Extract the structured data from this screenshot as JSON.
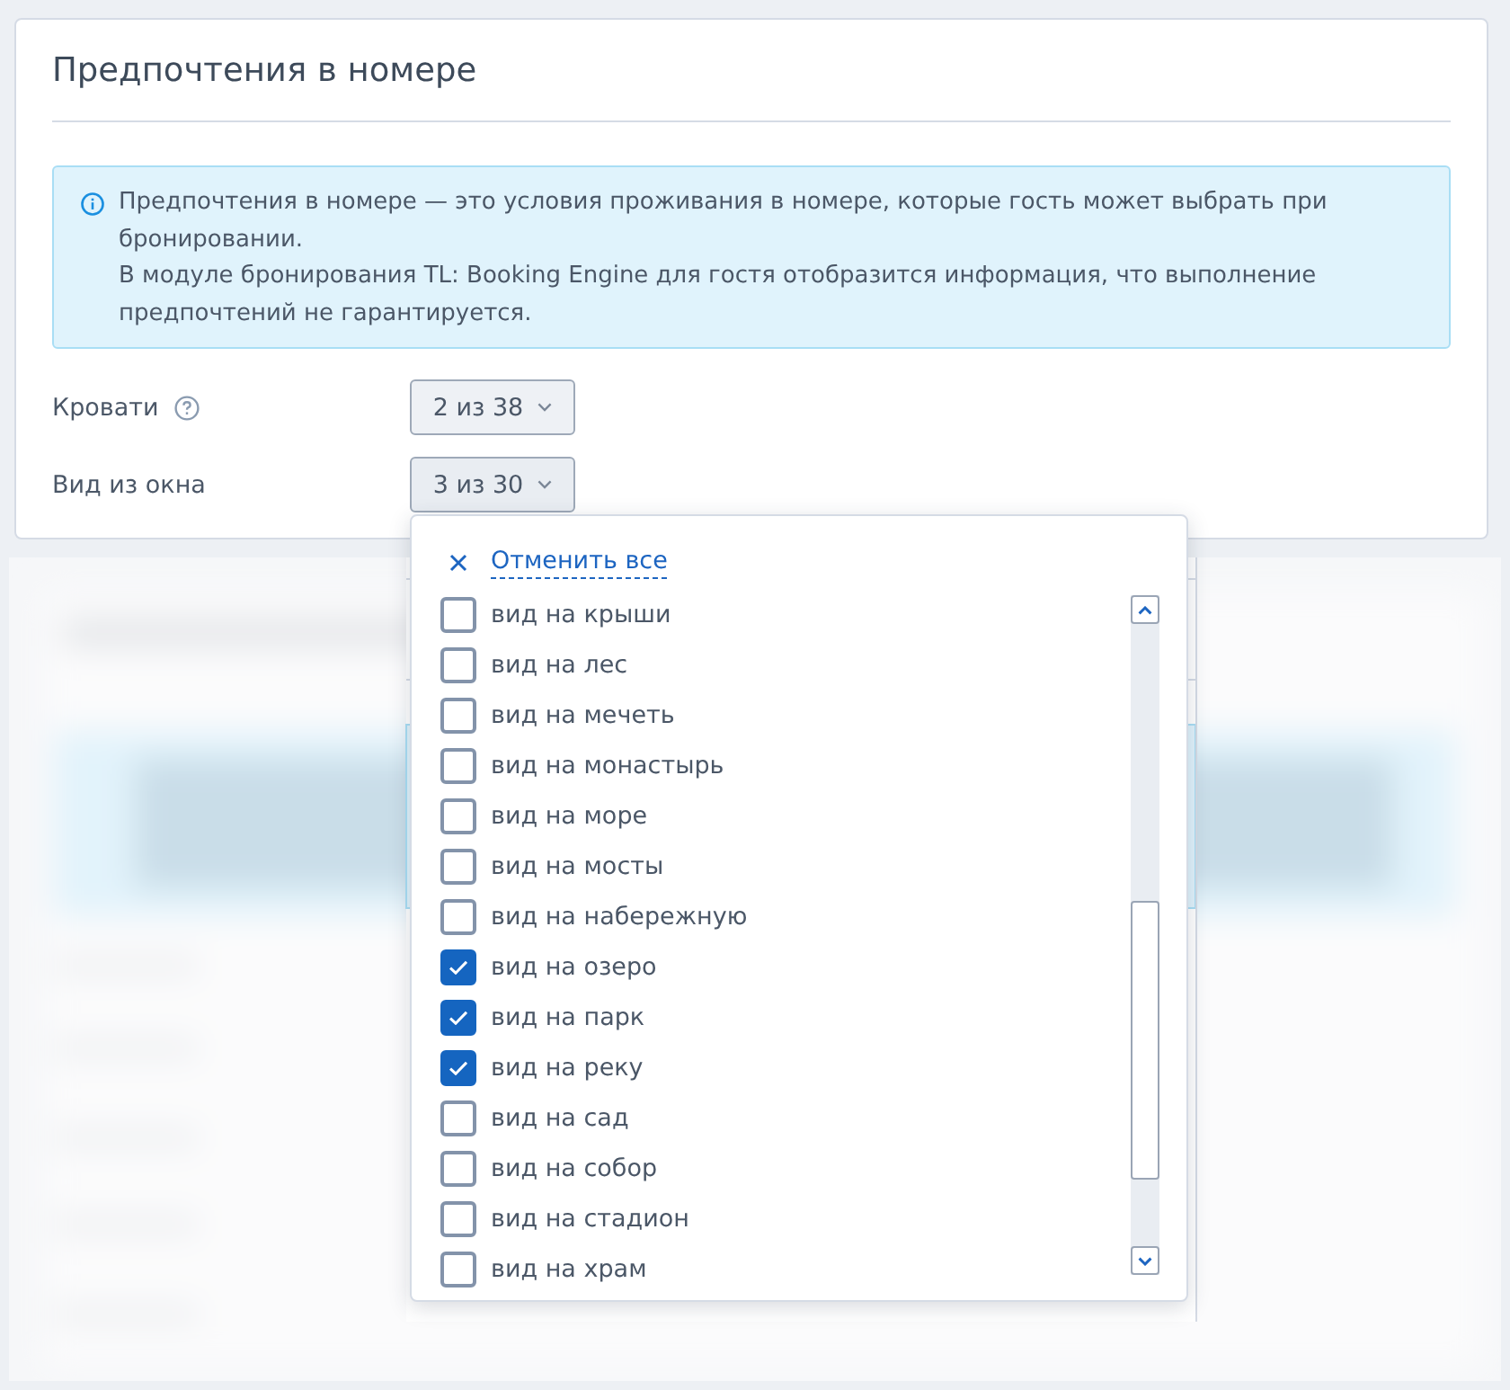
{
  "card": {
    "title": "Предпочтения в номере",
    "info": {
      "lines": [
        "Предпочтения в номере — это условия проживания в номере, которые гость может выбрать при бронировании.",
        "В модуле бронирования TL: Booking Engine для гостя отобразится информация, что выполнение предпочтений не гарантируется."
      ]
    },
    "fields": [
      {
        "label": "Кровати",
        "help": true,
        "value": "2 из 38",
        "expanded": false
      },
      {
        "label": "Вид из окна",
        "help": false,
        "value": "3 из 30",
        "expanded": true
      }
    ]
  },
  "dropdown": {
    "clear_all": "Отменить все",
    "options": [
      {
        "label": "вид на крыши",
        "checked": false
      },
      {
        "label": "вид на лес",
        "checked": false
      },
      {
        "label": "вид на мечеть",
        "checked": false
      },
      {
        "label": "вид на монастырь",
        "checked": false
      },
      {
        "label": "вид на море",
        "checked": false
      },
      {
        "label": "вид на мосты",
        "checked": false
      },
      {
        "label": "вид на набережную",
        "checked": false
      },
      {
        "label": "вид на озеро",
        "checked": true
      },
      {
        "label": "вид на парк",
        "checked": true
      },
      {
        "label": "вид на реку",
        "checked": true
      },
      {
        "label": "вид на сад",
        "checked": false
      },
      {
        "label": "вид на собор",
        "checked": false
      },
      {
        "label": "вид на стадион",
        "checked": false
      },
      {
        "label": "вид на храм",
        "checked": false
      }
    ]
  }
}
